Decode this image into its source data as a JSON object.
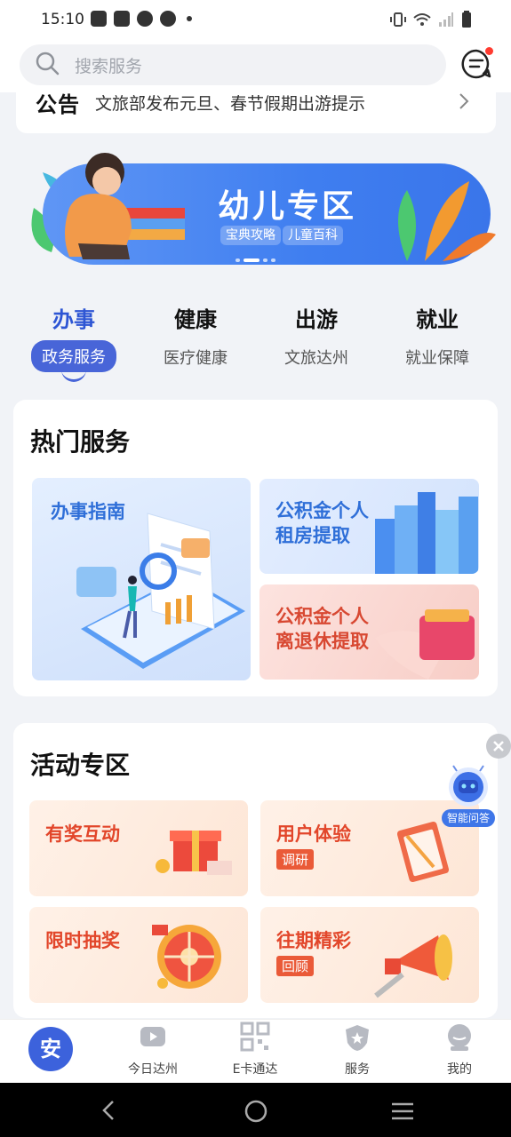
{
  "status_bar": {
    "time": "15:10"
  },
  "search": {
    "placeholder": "搜索服务"
  },
  "notice": {
    "tag": "公告",
    "text": "文旅部发布元旦、春节假期出游提示"
  },
  "banner": {
    "title": "幼儿专区",
    "tags": [
      "宝典攻略",
      "儿童百科"
    ]
  },
  "categories": [
    {
      "main": "办事",
      "sub": "政务服务",
      "active": true
    },
    {
      "main": "健康",
      "sub": "医疗健康"
    },
    {
      "main": "出游",
      "sub": "文旅达州"
    },
    {
      "main": "就业",
      "sub": "就业保障"
    }
  ],
  "hot_services": {
    "title": "热门服务",
    "items": [
      "办事指南",
      "公积金个人租房提取",
      "公积金个人离退休提取"
    ],
    "guide_label": "办事指南",
    "fund1_line1": "公积金个人",
    "fund1_line2": "租房提取",
    "fund2_line1": "公积金个人",
    "fund2_line2": "离退休提取"
  },
  "activities": {
    "title": "活动专区",
    "items": [
      {
        "title": "有奖互动",
        "sub": ""
      },
      {
        "title": "用户体验",
        "sub": "调研"
      },
      {
        "title": "限时抽奖",
        "sub": ""
      },
      {
        "title": "往期精彩",
        "sub": "回顾"
      }
    ]
  },
  "assistant": {
    "label": "智能问答"
  },
  "tab_bar": {
    "home_label": "安",
    "items": [
      "今日达州",
      "E卡通达",
      "服务",
      "我的"
    ]
  },
  "colors": {
    "accent": "#3c62dc",
    "activity_red": "#e2462a",
    "banner_blue": "#3f7ef0"
  }
}
